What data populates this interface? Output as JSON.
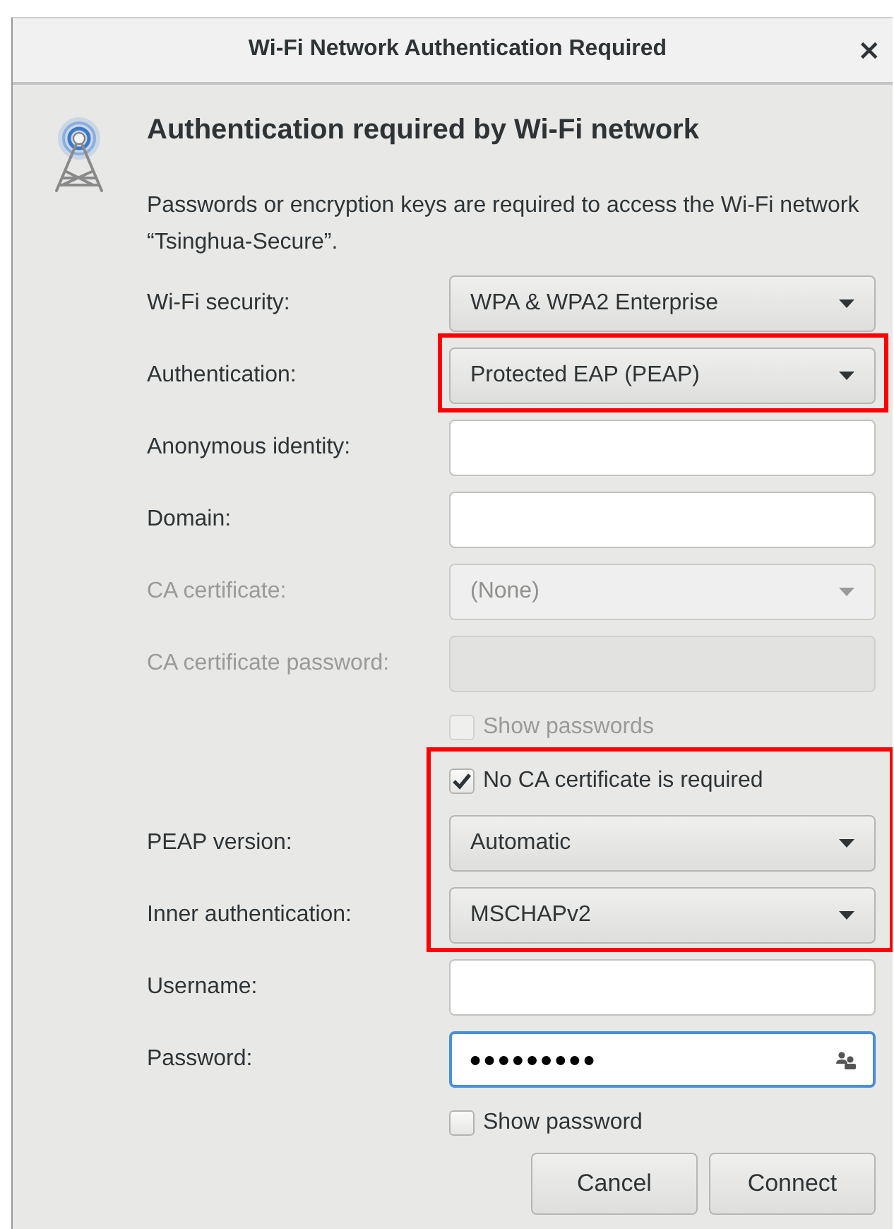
{
  "window": {
    "title": "Wi-Fi Network Authentication Required",
    "close": "×"
  },
  "header": {
    "title": "Authentication required by Wi-Fi network",
    "description": "Passwords or encryption keys are required to access the Wi-Fi network “Tsinghua-Secure”."
  },
  "sections": [
    {
      "marked": false,
      "rows": [
        {
          "kind": "combo",
          "label": "Wi-Fi security:",
          "value": "WPA & WPA2 Enterprise",
          "disabled": false
        }
      ]
    },
    {
      "marked": true,
      "rows": [
        {
          "kind": "combo",
          "label": "Authentication:",
          "value": "Protected EAP (PEAP)",
          "disabled": false
        }
      ]
    },
    {
      "marked": false,
      "rows": [
        {
          "kind": "entry",
          "label": "Anonymous identity:",
          "disabled": false,
          "focused": false
        },
        {
          "kind": "entry",
          "label": "Domain:",
          "disabled": false,
          "focused": false
        },
        {
          "kind": "combo",
          "label": "CA certificate:",
          "value": "(None)",
          "disabled": true
        },
        {
          "kind": "entry",
          "label": "CA certificate password:",
          "disabled": true,
          "focused": false
        },
        {
          "kind": "check",
          "label": "Show passwords",
          "checked": false,
          "disabled": true
        }
      ]
    },
    {
      "marked": true,
      "rows": [
        {
          "kind": "check",
          "label": "No CA certificate is required",
          "checked": true,
          "disabled": false
        },
        {
          "kind": "combo",
          "label": "PEAP version:",
          "value": "Automatic",
          "disabled": false
        },
        {
          "kind": "combo",
          "label": "Inner authentication:",
          "value": "MSCHAPv2",
          "disabled": false
        }
      ]
    },
    {
      "marked": false,
      "rows": [
        {
          "kind": "entry",
          "label": "Username:",
          "disabled": false,
          "focused": false
        },
        {
          "kind": "password",
          "label": "Password:",
          "value": "●●●●●●●●●",
          "disabled": false,
          "focused": true
        },
        {
          "kind": "check",
          "label": "Show password",
          "checked": false,
          "disabled": false
        }
      ]
    }
  ],
  "buttons": [
    {
      "label": "Cancel"
    },
    {
      "label": "Connect"
    }
  ]
}
